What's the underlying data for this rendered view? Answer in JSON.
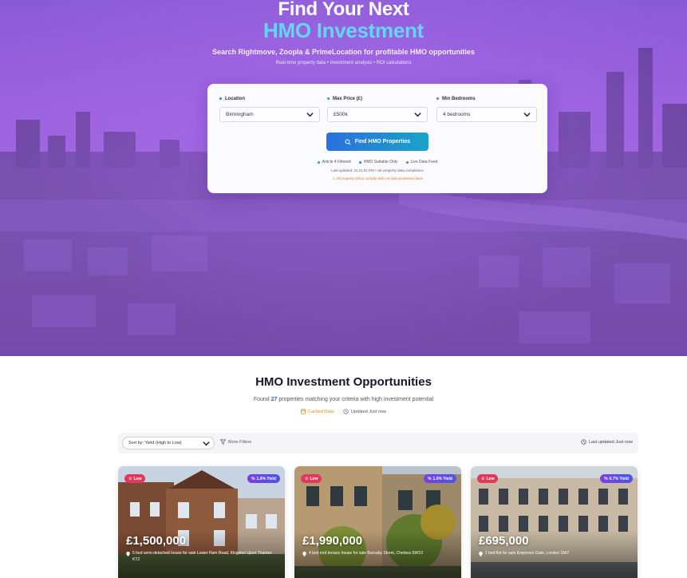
{
  "hero": {
    "title_line1": "Find Your Next",
    "title_line2": "HMO Investment",
    "subtitle": "Search Rightmove, Zoopla & PrimeLocation for profitable HMO opportunities",
    "tagline": "Real-time property data • Investment analysis • ROI calculations",
    "colors": {
      "background": "#9d62df",
      "accent": "#63d7f2"
    }
  },
  "search": {
    "location": {
      "label": "Location",
      "value": "Birmingham",
      "dot_color": "#2f7be0"
    },
    "max_price": {
      "label": "Max Price (£)",
      "value": "£500k",
      "dot_color": "#22b573"
    },
    "min_bedrooms": {
      "label": "Min Bedrooms",
      "value": "4 bedrooms",
      "dot_color": "#9b59d6"
    },
    "button_label": "Find HMO Properties",
    "tags": [
      {
        "label": "Article 4 Filtered",
        "color": "#22b573"
      },
      {
        "label": "HMO Suitable Only",
        "color": "#2f7be0"
      },
      {
        "label": "Live Data Feed",
        "color": "#9b59d6"
      }
    ],
    "last_updated": "Last updated: 11:21:01 PM • UK property data compliance",
    "compliance_note": "All property URLs comply with UK data protection laws"
  },
  "results": {
    "title": "HMO Investment Opportunities",
    "sub_prefix": "Found",
    "count": "27",
    "sub_suffix": "properties matching your criteria with high investment potential",
    "cached_label": "Cached Data",
    "updated_label": "Updated Just now",
    "sort_value": "Sort by: Yield (High to Low)",
    "more_filters": "More Filters",
    "toolbar_updated": "Last updated Just now"
  },
  "properties": [
    {
      "risk": "Low",
      "yield": "1.6% Yield",
      "price": "£1,500,000",
      "address": "5 bed semi-detached house for sale Lower Ham Road, Kingston Upon Thames KT2"
    },
    {
      "risk": "Low",
      "yield": "1.0% Yield",
      "price": "£1,990,000",
      "address": "4 bed end terrace house for sale Burnaby Street, Chelsea SW10"
    },
    {
      "risk": "Low",
      "yield": "0.7% Yield",
      "price": "£695,000",
      "address": "1 bed flat for sale Emperors Gate, London SW7"
    }
  ]
}
